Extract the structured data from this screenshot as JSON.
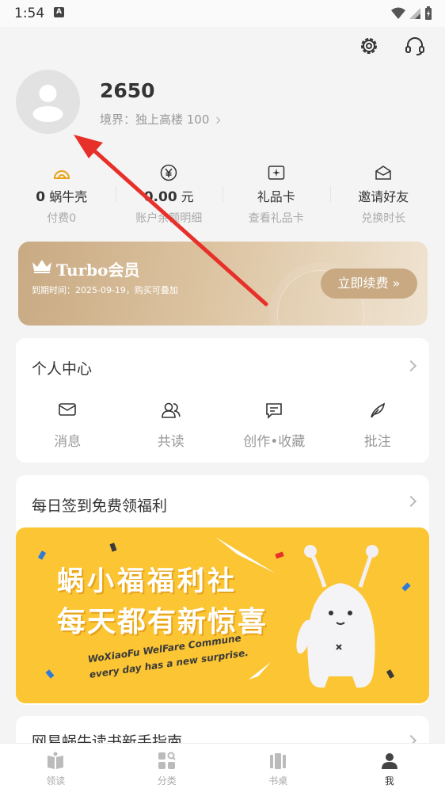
{
  "status": {
    "time": "1:54",
    "a_badge": "A"
  },
  "header": {
    "icons": [
      "gear-icon",
      "headset-icon"
    ]
  },
  "profile": {
    "username": "2650",
    "realm": "境界：独上高楼 100"
  },
  "stats": [
    {
      "value": "0",
      "unit": "蜗牛壳",
      "sub": "付费0",
      "icon": "snail-shell-icon"
    },
    {
      "value": "0.00",
      "unit": "元",
      "sub": "账户余额明细",
      "icon": "yuan-icon"
    },
    {
      "value": "",
      "unit": "礼品卡",
      "sub": "查看礼品卡",
      "icon": "gift-card-icon"
    },
    {
      "value": "",
      "unit": "邀请好友",
      "sub": "兑换时长",
      "icon": "invite-icon"
    }
  ],
  "vip": {
    "title": "Turbo会员",
    "expiry": "到期时间：2025-09-19，购买可叠加",
    "button": "立即续费 »"
  },
  "personal_center": {
    "title": "个人中心",
    "items": [
      {
        "label": "消息",
        "icon": "mail-icon"
      },
      {
        "label": "共读",
        "icon": "people-icon"
      },
      {
        "label": "创作•收藏",
        "icon": "comment-icon"
      },
      {
        "label": "批注",
        "icon": "feather-icon"
      }
    ]
  },
  "signin": {
    "title": "每日签到免费领福利",
    "banner_line1": "蜗小福福利社",
    "banner_line2": "每天都有新惊喜",
    "banner_en1": "WoXiaoFu WelFare Commune",
    "banner_en2": "every day has a new surprise."
  },
  "guide": {
    "title": "网易蜗牛读书新手指南"
  },
  "tabbar": [
    {
      "label": "领读",
      "icon": "book-open-icon",
      "active": false
    },
    {
      "label": "分类",
      "icon": "grid-search-icon",
      "active": false
    },
    {
      "label": "书桌",
      "icon": "bookshelf-icon",
      "active": false
    },
    {
      "label": "我",
      "icon": "person-icon",
      "active": true
    }
  ],
  "colors": {
    "accent_red": "#e8302a",
    "vip_gold": "#c8a982",
    "banner_yellow": "#fcc534"
  }
}
